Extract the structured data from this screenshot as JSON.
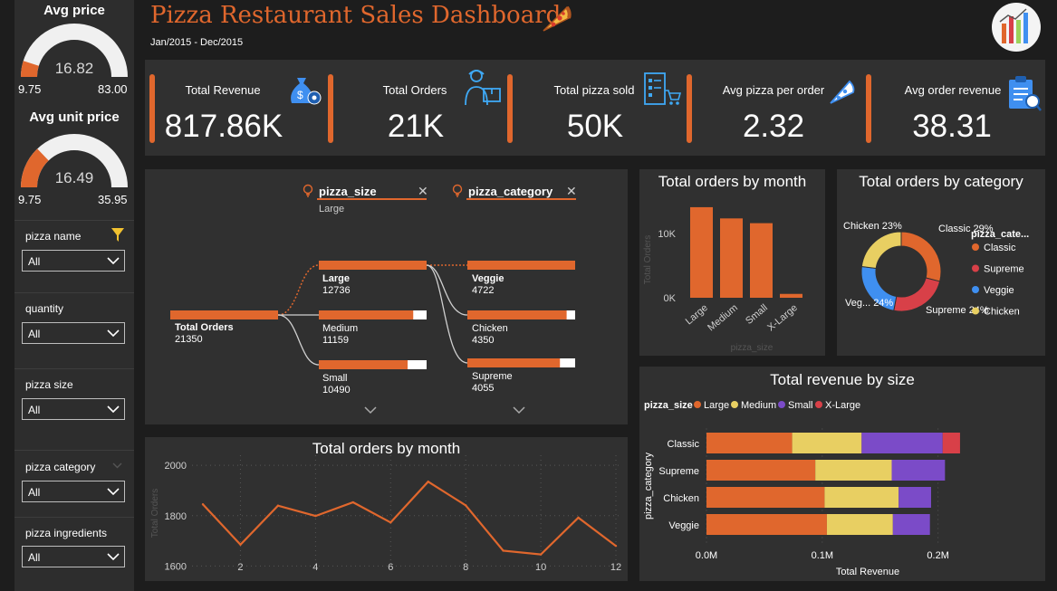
{
  "sidebar": {
    "avg_price": {
      "title": "Avg price",
      "value": "16.82",
      "min": "9.75",
      "max": "83.00",
      "fraction": 0.097
    },
    "avg_unit_price": {
      "title": "Avg unit price",
      "value": "16.49",
      "min": "9.75",
      "max": "35.95",
      "fraction": 0.257
    },
    "slicers": [
      {
        "label": "pizza name",
        "value": "All",
        "icon": "filter-icon"
      },
      {
        "label": "quantity",
        "value": "All"
      },
      {
        "label": "pizza size",
        "value": "All"
      },
      {
        "label": "pizza category",
        "value": "All",
        "icon": "chevron-down-icon"
      },
      {
        "label": "pizza ingredients",
        "value": "All"
      }
    ]
  },
  "header": {
    "title": "Pizza Restaurant Sales Dashboard",
    "subtitle": "Jan/2015 - Dec/2015",
    "title_icon": "pizza-slice-icon",
    "logo_icon": "dashboard-chart-logo-icon"
  },
  "kpis": [
    {
      "label": "Total Revenue",
      "value": "817.86K",
      "icon": "money-bag-icon"
    },
    {
      "label": "Total Orders",
      "value": "21K",
      "icon": "delivery-person-icon"
    },
    {
      "label": "Total pizza sold",
      "value": "50K",
      "icon": "checklist-cart-icon"
    },
    {
      "label": "Avg pizza per order",
      "value": "2.32",
      "icon": "pizza-slice-icon"
    },
    {
      "label": "Avg order revenue",
      "value": "38.31",
      "icon": "clipboard-report-icon"
    }
  ],
  "decomposition": {
    "filters": [
      {
        "field": "pizza_size",
        "selected": "Large"
      },
      {
        "field": "pizza_category",
        "selected": ""
      }
    ],
    "root": {
      "label": "Total Orders",
      "value": "21350",
      "fraction": 1.0
    },
    "size_nodes": [
      {
        "label": "Large",
        "value": "12736",
        "fraction": 1.0
      },
      {
        "label": "Medium",
        "value": "11159",
        "fraction": 0.876
      },
      {
        "label": "Small",
        "value": "10490",
        "fraction": 0.824
      }
    ],
    "category_nodes": [
      {
        "label": "Veggie",
        "value": "4722",
        "fraction": 1.0
      },
      {
        "label": "Chicken",
        "value": "4350",
        "fraction": 0.921
      },
      {
        "label": "Supreme",
        "value": "4055",
        "fraction": 0.859
      }
    ]
  },
  "colors": {
    "accent": "#e0672d",
    "classic": "#e0672d",
    "supreme": "#d84048",
    "veggie": "#3f8ff0",
    "chicken": "#e8cf62",
    "small": "#7b4bc8",
    "xlarge": "#d84048"
  },
  "chart_data": [
    {
      "type": "bar",
      "title": "Total orders by month",
      "categories": [
        "Large",
        "Medium",
        "Small",
        "X-Large"
      ],
      "values": [
        12736,
        11159,
        10490,
        544
      ],
      "ylabel": "Total Orders",
      "xlabel": "pizza_size",
      "yticks": [
        "0K",
        "10K"
      ],
      "ylim": [
        0,
        14000
      ]
    },
    {
      "type": "pie",
      "title": "Total orders by category",
      "legend_title": "pizza_cate...",
      "categories": [
        "Classic",
        "Supreme",
        "Veggie",
        "Chicken"
      ],
      "values": [
        29,
        24,
        24,
        23
      ],
      "labels": [
        "Classic 29%",
        "Supreme 24%",
        "Veg... 24%",
        "Chicken 23%"
      ]
    },
    {
      "type": "bar",
      "title": "Total revenue by size",
      "legend_title": "pizza_size",
      "categories": [
        "Classic",
        "Supreme",
        "Chicken",
        "Veggie"
      ],
      "series": [
        {
          "name": "Large",
          "values": [
            74000,
            94000,
            102000,
            104000
          ]
        },
        {
          "name": "Medium",
          "values": [
            60000,
            66000,
            64000,
            57000
          ]
        },
        {
          "name": "Small",
          "values": [
            70000,
            46000,
            28000,
            32000
          ]
        },
        {
          "name": "X-Large",
          "values": [
            15000,
            0,
            0,
            0
          ]
        }
      ],
      "xticks": [
        "0.0M",
        "0.1M",
        "0.2M"
      ],
      "xlim": [
        0,
        230000
      ],
      "xlabel": "Total Revenue",
      "ylabel": "pizza_category"
    },
    {
      "type": "line",
      "title": "Total orders by month",
      "x": [
        1,
        2,
        3,
        4,
        5,
        6,
        7,
        8,
        9,
        10,
        11,
        12
      ],
      "values": [
        1845,
        1685,
        1840,
        1799,
        1853,
        1773,
        1935,
        1841,
        1661,
        1646,
        1792,
        1680
      ],
      "xticks": [
        "2",
        "4",
        "6",
        "8",
        "10",
        "12"
      ],
      "yticks": [
        "1600",
        "1800",
        "2000"
      ],
      "ylim": [
        1580,
        2040
      ],
      "ylabel": "Total Orders"
    }
  ]
}
